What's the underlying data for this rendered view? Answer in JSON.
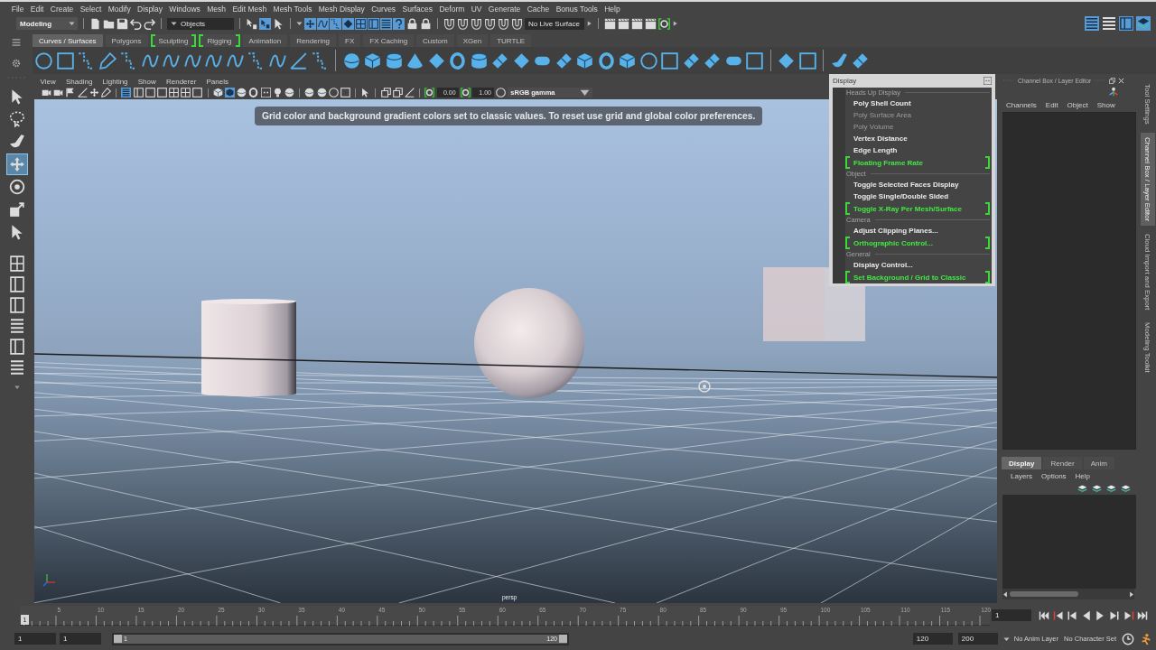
{
  "menu_bar": {
    "items": [
      "File",
      "Edit",
      "Create",
      "Select",
      "Modify",
      "Display",
      "Windows",
      "Mesh",
      "Edit Mesh",
      "Mesh Tools",
      "Mesh Display",
      "Curves",
      "Surfaces",
      "Deform",
      "UV",
      "Generate",
      "Cache",
      "Bonus Tools",
      "Help"
    ]
  },
  "status_line": {
    "menu_set": "Modeling",
    "selection_mode": "Objects",
    "live_surface": "No Live Surface",
    "hierarchy_toggles": [
      {
        "on": false
      },
      {
        "on": true
      },
      {
        "on": false
      }
    ],
    "mask_toggles": [
      {
        "on": true
      },
      {
        "on": true
      },
      {
        "on": true
      },
      {
        "on": true
      },
      {
        "on": true
      },
      {
        "on": true
      },
      {
        "on": true
      },
      {
        "on": true
      }
    ],
    "panel_toggles": [
      {
        "on": true
      },
      {
        "on": false
      },
      {
        "on": true
      },
      {
        "on": true
      }
    ]
  },
  "shelf": {
    "tabs": [
      {
        "label": "Curves / Surfaces",
        "selected": true,
        "highlighted": false
      },
      {
        "label": "Polygons",
        "selected": false,
        "highlighted": false
      },
      {
        "label": "Sculpting",
        "selected": false,
        "highlighted": true
      },
      {
        "label": "Rigging",
        "selected": false,
        "highlighted": true
      },
      {
        "label": "Animation",
        "selected": false,
        "highlighted": false
      },
      {
        "label": "Rendering",
        "selected": false,
        "highlighted": false
      },
      {
        "label": "FX",
        "selected": false,
        "highlighted": false
      },
      {
        "label": "FX Caching",
        "selected": false,
        "highlighted": false
      },
      {
        "label": "Custom",
        "selected": false,
        "highlighted": false
      },
      {
        "label": "XGen",
        "selected": false,
        "highlighted": false
      },
      {
        "label": "TURTLE",
        "selected": false,
        "highlighted": false
      }
    ]
  },
  "toolbox": {
    "tools": [
      {
        "selected": false
      },
      {
        "selected": false
      },
      {
        "selected": false
      },
      {
        "selected": true
      },
      {
        "selected": false
      },
      {
        "selected": false
      },
      {
        "selected": false
      }
    ]
  },
  "viewport": {
    "menus": [
      "View",
      "Shading",
      "Lighting",
      "Show",
      "Renderer",
      "Panels"
    ],
    "display_toggles": [
      {
        "on": true
      },
      {
        "on": false
      },
      {
        "on": false
      },
      {
        "on": false
      },
      {
        "on": false
      },
      {
        "on": false
      },
      {
        "on": false
      }
    ],
    "shading_toggles": [
      {
        "on": false
      },
      {
        "on": true
      },
      {
        "on": false
      },
      {
        "on": false
      },
      {
        "on": false
      },
      {
        "on": false
      },
      {
        "on": false
      }
    ],
    "exposure": "0.00",
    "gamma": "1.00",
    "color_space": "sRGB gamma",
    "message": "Grid color and background gradient colors set to classic values. To reset use grid and global color preferences.",
    "camera": "persp"
  },
  "display_window": {
    "title": "Display",
    "sections": [
      {
        "heading": "Heads Up Display",
        "items": [
          {
            "label": "Poly Shell Count",
            "disabled": false,
            "highlighted": false
          },
          {
            "label": "Poly Surface Area",
            "disabled": true,
            "highlighted": false
          },
          {
            "label": "Poly Volume",
            "disabled": true,
            "highlighted": false
          },
          {
            "label": "Vertex Distance",
            "disabled": false,
            "highlighted": false
          },
          {
            "label": "Edge Length",
            "disabled": false,
            "highlighted": false
          },
          {
            "label": "Floating Frame Rate",
            "disabled": false,
            "highlighted": true
          }
        ]
      },
      {
        "heading": "Object",
        "items": [
          {
            "label": "Toggle Selected Faces Display",
            "disabled": false,
            "highlighted": false
          },
          {
            "label": "Toggle Single/Double Sided",
            "disabled": false,
            "highlighted": false
          },
          {
            "label": "Toggle X-Ray Per Mesh/Surface",
            "disabled": false,
            "highlighted": true
          }
        ]
      },
      {
        "heading": "Camera",
        "items": [
          {
            "label": "Adjust Clipping Planes...",
            "disabled": false,
            "highlighted": false
          },
          {
            "label": "Orthographic Control...",
            "disabled": false,
            "highlighted": true
          }
        ]
      },
      {
        "heading": "General",
        "items": [
          {
            "label": "Display Control...",
            "disabled": false,
            "highlighted": false
          },
          {
            "label": "Set Background / Grid to Classic",
            "disabled": false,
            "highlighted": true
          }
        ]
      }
    ]
  },
  "channel_box": {
    "title": "Channel Box / Layer Editor",
    "menus": [
      "Channels",
      "Edit",
      "Object",
      "Show"
    ]
  },
  "layer_editor": {
    "tabs": [
      {
        "label": "Display",
        "selected": true
      },
      {
        "label": "Render",
        "selected": false
      },
      {
        "label": "Anim",
        "selected": false
      }
    ],
    "menus": [
      "Layers",
      "Options",
      "Help"
    ]
  },
  "side_tabs": [
    {
      "label": "Tool Settings",
      "selected": false
    },
    {
      "label": "Channel Box / Layer Editor",
      "selected": true
    },
    {
      "label": "Cloud Import and Export",
      "selected": false
    },
    {
      "label": "Modeling Toolkit",
      "selected": false
    }
  ],
  "time_slider": {
    "labels": [
      "5",
      "10",
      "15",
      "20",
      "25",
      "30",
      "35",
      "40",
      "45",
      "50",
      "55",
      "60",
      "65",
      "70",
      "75",
      "80",
      "85",
      "90",
      "95",
      "100",
      "105",
      "110",
      "115",
      "120"
    ],
    "current_frame": "1",
    "frame_field": "1"
  },
  "range_slider": {
    "start": "1",
    "playback_start": "1",
    "handle_start": "1",
    "handle_end": "120",
    "playback_end": "120",
    "end": "200",
    "anim_layer": "No Anim Layer",
    "character_set": "No Character Set"
  }
}
